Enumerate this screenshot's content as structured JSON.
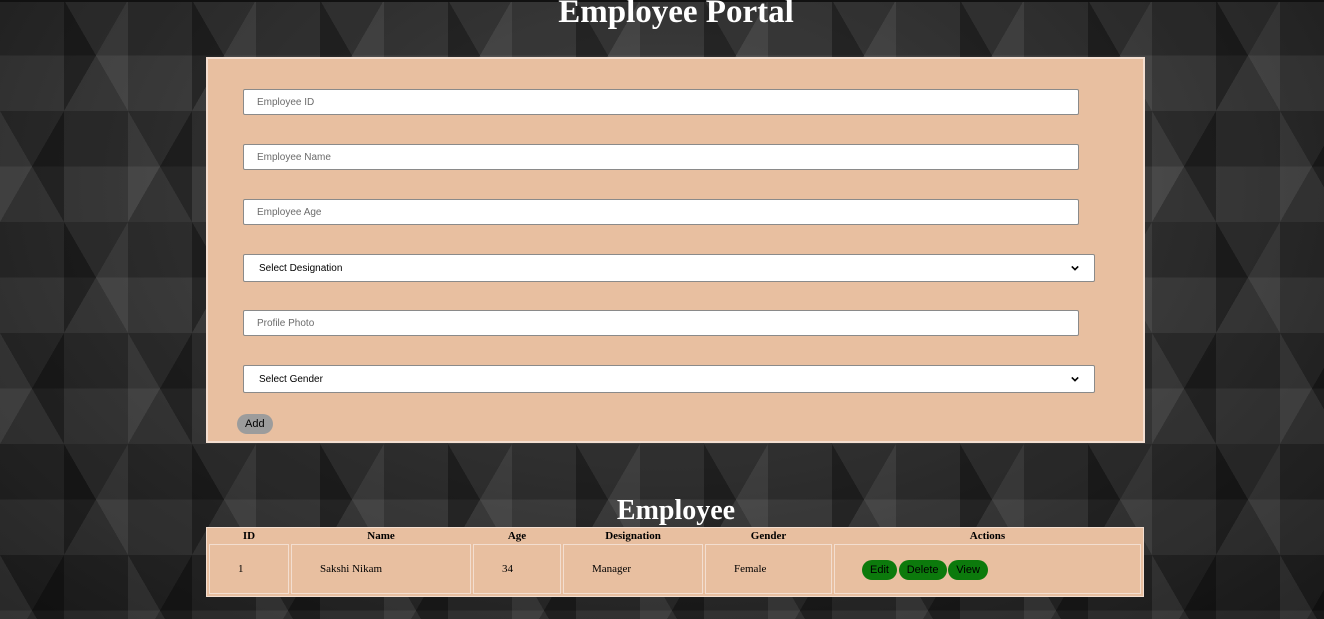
{
  "header": {
    "title": "Employee Portal"
  },
  "form": {
    "employee_id_placeholder": "Employee ID",
    "employee_name_placeholder": "Employee Name",
    "employee_age_placeholder": "Employee Age",
    "designation_selected": "Select Designation",
    "profile_photo_placeholder": "Profile Photo",
    "gender_selected": "Select Gender",
    "add_label": "Add"
  },
  "table": {
    "title": "Employee",
    "columns": [
      "ID",
      "Name",
      "Age",
      "Designation",
      "Gender",
      "Actions"
    ],
    "rows": [
      {
        "id": "1",
        "name": "Sakshi Nikam",
        "age": "34",
        "designation": "Manager",
        "gender": "Female",
        "actions": [
          "Edit",
          "Delete",
          "View"
        ]
      }
    ]
  },
  "colors": {
    "panel": "#e8bfa0",
    "panel_border": "#f3ded0",
    "add_button": "#9c9c9c",
    "action_button": "#0c7a0c",
    "title_text": "#ffffff"
  },
  "icons": {
    "select_arrow": "chevron-down-icon"
  }
}
